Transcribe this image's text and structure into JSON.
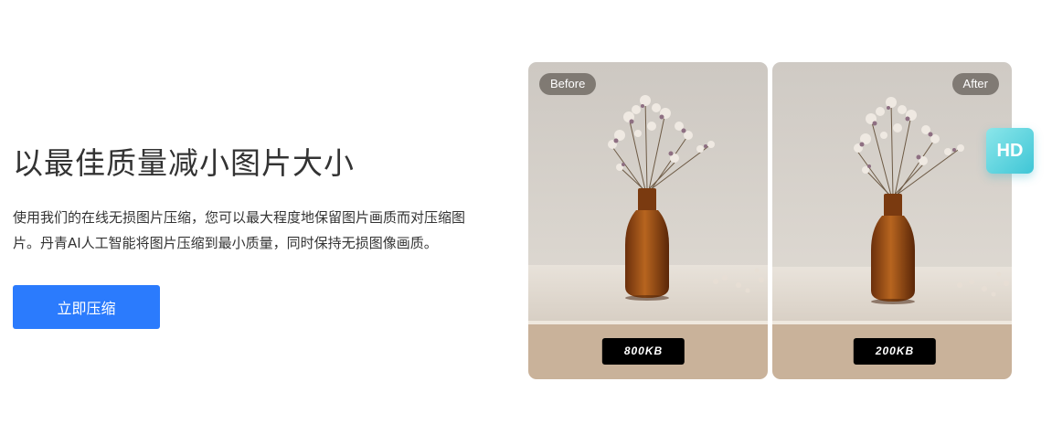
{
  "hero": {
    "title": "以最佳质量减小图片大小",
    "description": "使用我们的在线无损图片压缩，您可以最大程度地保留图片画质而对压缩图片。丹青AI人工智能将图片压缩到最小质量，同时保持无损图像画质。",
    "cta_label": "立即压缩"
  },
  "comparison": {
    "before_label": "Before",
    "after_label": "After",
    "before_size": "800KB",
    "after_size": "200KB",
    "hd_label": "HD"
  },
  "colors": {
    "accent": "#2b7bfd",
    "hd_gradient_start": "#8be6ea",
    "hd_gradient_end": "#3fc6d6"
  }
}
